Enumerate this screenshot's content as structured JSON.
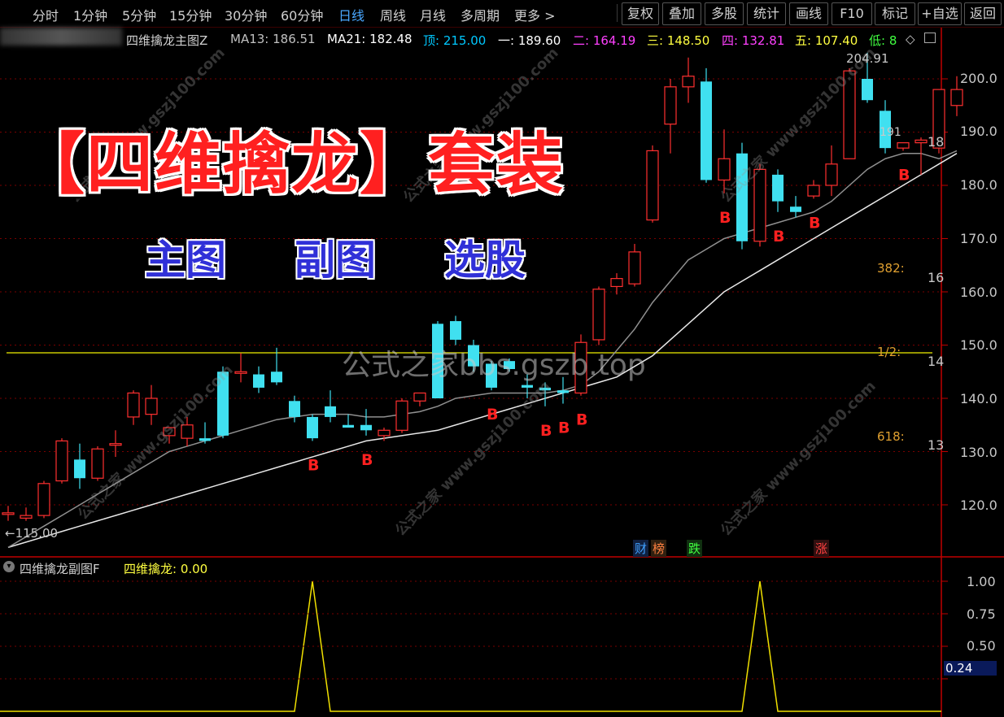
{
  "toolbar": {
    "periods": [
      "分时",
      "1分钟",
      "5分钟",
      "15分钟",
      "30分钟",
      "60分钟",
      "日线",
      "周线",
      "月线",
      "多周期",
      "更多 >"
    ],
    "active_period": "日线",
    "buttons": [
      "复权",
      "叠加",
      "多股",
      "统计",
      "画线",
      "F10",
      "标记",
      "+自选",
      "返回"
    ]
  },
  "main_header": {
    "indicator": "四维擒龙主图Z",
    "ma13": "MA13: 186.51",
    "ma21": "MA21: 182.48",
    "top": "顶: 215.00",
    "l1": "一: 189.60",
    "l2": "二: 164.19",
    "l3": "三: 148.50",
    "l4": "四: 132.81",
    "l5": "五: 107.40",
    "low": "低: 8",
    "low_suffix": "◇",
    "colors": {
      "top": "#00c8ff",
      "l1": "#ffffff",
      "l2": "#ff40ff",
      "l3": "#ffff40",
      "l4": "#ff40ff",
      "l5": "#ffff40",
      "low": "#40ff40"
    }
  },
  "promo": {
    "title": "【四维擒龙】套装",
    "subs": [
      "主图",
      "副图",
      "选股"
    ]
  },
  "watermark": "公式之家bbs.gszb.top",
  "diag_watermark": "公式之家 www.gszj100.com",
  "price_axis": {
    "labels": [
      "200.0",
      "190.0",
      "180.0",
      "170.0",
      "160.0",
      "150.0",
      "140.0",
      "130.0",
      "120.0"
    ],
    "partial": [
      "18",
      "16",
      "14",
      "13"
    ]
  },
  "fib_labels": {
    "f382": "382:",
    "half": "1/2:",
    "f618": "618:"
  },
  "annotations": {
    "high": "204.91",
    "low": "←115.00",
    "cursor": "191"
  },
  "events": [
    {
      "text": "财",
      "color": "#40a0ff",
      "bg": "#102040"
    },
    {
      "text": "榜",
      "color": "#ff8040",
      "bg": "#302010"
    },
    {
      "text": "跌",
      "color": "#40ff40",
      "bg": "#103010"
    },
    {
      "text": "涨",
      "color": "#ff4040",
      "bg": "#301010"
    }
  ],
  "sub_panel": {
    "title": "四维擒龙副图F",
    "value": "四维擒龙: 0.00",
    "axis": [
      "1.00",
      "0.75",
      "0.50"
    ],
    "current": "0.24"
  },
  "chart_data": {
    "type": "candlestick",
    "ylim": [
      112,
      207
    ],
    "candles": [
      [
        118.5,
        119.8,
        117.0,
        118.5
      ],
      [
        117.5,
        119.5,
        117.0,
        118.0
      ],
      [
        118.0,
        124.5,
        117.5,
        124.0
      ],
      [
        124.5,
        132.5,
        124.0,
        132.0
      ],
      [
        128.5,
        131.5,
        123.0,
        125.0
      ],
      [
        125.0,
        131.0,
        124.5,
        130.5
      ],
      [
        131.5,
        134.0,
        129.0,
        131.5
      ],
      [
        136.5,
        141.5,
        135.0,
        141.0
      ],
      [
        137.0,
        142.5,
        135.0,
        140.0
      ],
      [
        133.0,
        134.5,
        131.5,
        134.5
      ],
      [
        132.5,
        136.5,
        131.0,
        135.0
      ],
      [
        132.5,
        135.5,
        131.5,
        132.0
      ],
      [
        145.0,
        146.0,
        132.5,
        133.0
      ],
      [
        145.0,
        148.5,
        143.0,
        145.0
      ],
      [
        144.5,
        146.0,
        141.0,
        142.0
      ],
      [
        145.0,
        149.5,
        142.5,
        143.0
      ],
      [
        139.5,
        140.5,
        135.5,
        136.5
      ],
      [
        136.5,
        137.0,
        132.0,
        132.5
      ],
      [
        138.5,
        141.5,
        135.5,
        136.5
      ],
      [
        135.0,
        137.0,
        134.5,
        134.5
      ],
      [
        135.0,
        138.0,
        133.0,
        134.0
      ],
      [
        133.0,
        134.5,
        132.0,
        134.0
      ],
      [
        134.0,
        140.0,
        133.5,
        139.5
      ],
      [
        139.5,
        141.0,
        138.5,
        141.0
      ],
      [
        154.0,
        154.5,
        140.0,
        140.0
      ],
      [
        154.5,
        155.5,
        150.0,
        151.0
      ],
      [
        150.0,
        151.0,
        145.0,
        146.0
      ],
      [
        146.5,
        147.0,
        141.5,
        142.0
      ],
      [
        147.0,
        147.5,
        145.0,
        145.5
      ],
      [
        142.5,
        144.5,
        140.0,
        142.0
      ],
      [
        142.0,
        143.0,
        138.5,
        141.5
      ],
      [
        141.5,
        144.0,
        139.0,
        141.0
      ],
      [
        141.0,
        152.0,
        140.5,
        150.5
      ],
      [
        151.0,
        161.0,
        150.0,
        160.5
      ],
      [
        161.0,
        163.5,
        159.5,
        162.5
      ],
      [
        161.5,
        169.0,
        161.0,
        167.5
      ],
      [
        173.5,
        187.5,
        173.0,
        186.5
      ],
      [
        191.5,
        200.0,
        186.0,
        198.5
      ],
      [
        198.5,
        204.0,
        195.5,
        200.5
      ],
      [
        199.5,
        202.0,
        180.5,
        181.0
      ],
      [
        181.0,
        190.5,
        178.5,
        185.0
      ],
      [
        186.0,
        188.0,
        168.0,
        169.5
      ],
      [
        169.5,
        184.0,
        168.5,
        183.0
      ],
      [
        182.0,
        183.0,
        175.0,
        177.0
      ],
      [
        176.0,
        178.0,
        174.0,
        175.0
      ],
      [
        178.0,
        181.0,
        177.5,
        180.0
      ],
      [
        180.0,
        187.5,
        178.0,
        184.0
      ],
      [
        185.0,
        202.0,
        185.0,
        201.5
      ],
      [
        200.0,
        204.9,
        195.5,
        196.0
      ],
      [
        194.0,
        196.0,
        186.0,
        187.0
      ],
      [
        187.0,
        188.0,
        186.5,
        188.0
      ],
      [
        188.0,
        189.0,
        182.0,
        188.5
      ],
      [
        187.0,
        197.5,
        186.0,
        198.0
      ],
      [
        195.0,
        200.5,
        193.0,
        198.0
      ]
    ],
    "ma13": [
      112,
      114,
      116,
      118,
      120,
      122,
      124,
      126,
      128,
      130,
      131,
      132,
      133,
      134,
      135,
      136,
      136.5,
      137,
      137,
      137,
      136.5,
      136.5,
      137,
      137.5,
      138.5,
      140,
      140.5,
      141,
      141,
      141,
      141,
      141.5,
      142.5,
      145,
      149,
      153,
      158,
      162,
      166,
      168,
      170,
      171,
      172,
      173,
      174,
      175,
      177,
      180,
      183,
      185,
      186,
      186,
      185,
      186.5
    ],
    "ma21": [
      112,
      113,
      114,
      115,
      116,
      117,
      118,
      119,
      120,
      121,
      122,
      123,
      124,
      125,
      126,
      127,
      128,
      129,
      130,
      131,
      132,
      132.5,
      133,
      133.5,
      134,
      135,
      136,
      137,
      138,
      139,
      140,
      141,
      142,
      143,
      144,
      146,
      148,
      151,
      154,
      157,
      160,
      162,
      164,
      166,
      168,
      170,
      172,
      174,
      176,
      178,
      180,
      182,
      184,
      186
    ],
    "signals_b": [
      17,
      20,
      27,
      30,
      31,
      32,
      40,
      43,
      45,
      50
    ],
    "sub_peaks": [
      17,
      42
    ]
  }
}
